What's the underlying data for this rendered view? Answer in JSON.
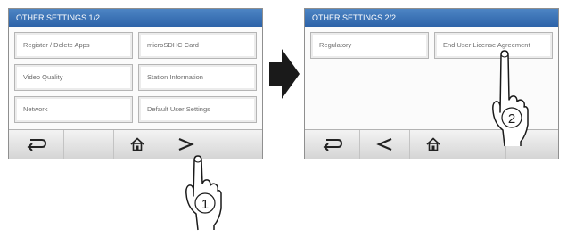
{
  "screen1": {
    "title": "OTHER SETTINGS  1/2",
    "items": [
      "Register / Delete Apps",
      "microSDHC Card",
      "Video Quality",
      "Station Information",
      "Network",
      "Default User Settings"
    ],
    "nav": [
      "back-icon",
      "home-icon",
      "next-icon"
    ]
  },
  "screen2": {
    "title": "OTHER SETTINGS 2/2",
    "items": [
      "Regulatory",
      "End User License Agreement"
    ],
    "nav": [
      "back-icon",
      "previous-icon",
      "home-icon"
    ]
  },
  "steps": {
    "step1": "1",
    "step2": "2"
  },
  "colors": {
    "title_bar": "#2f65aa",
    "screen_border": "#8f8f8f",
    "arrow": "#1a1a1a"
  }
}
